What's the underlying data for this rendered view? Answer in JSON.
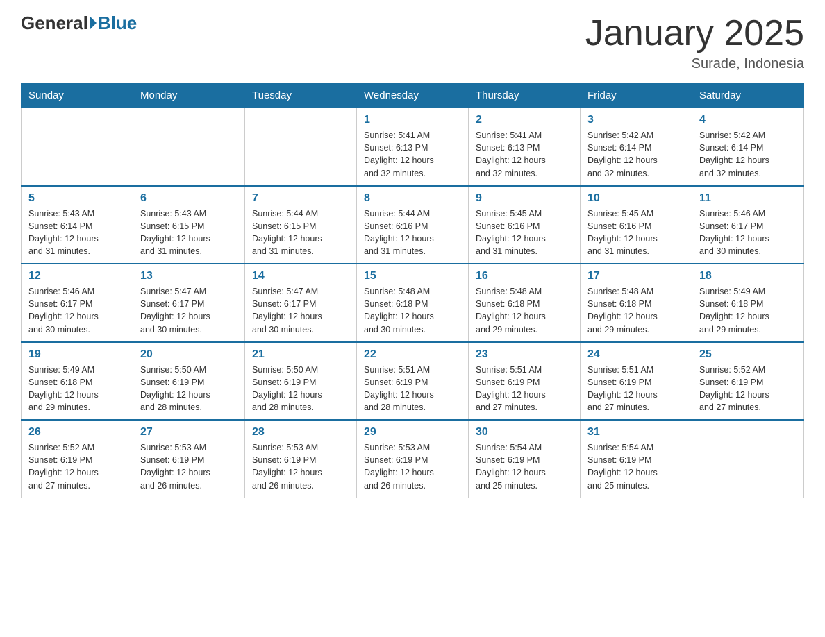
{
  "header": {
    "logo_general": "General",
    "logo_blue": "Blue",
    "month_title": "January 2025",
    "location": "Surade, Indonesia"
  },
  "weekdays": [
    "Sunday",
    "Monday",
    "Tuesday",
    "Wednesday",
    "Thursday",
    "Friday",
    "Saturday"
  ],
  "weeks": [
    [
      {
        "day": "",
        "info": ""
      },
      {
        "day": "",
        "info": ""
      },
      {
        "day": "",
        "info": ""
      },
      {
        "day": "1",
        "info": "Sunrise: 5:41 AM\nSunset: 6:13 PM\nDaylight: 12 hours\nand 32 minutes."
      },
      {
        "day": "2",
        "info": "Sunrise: 5:41 AM\nSunset: 6:13 PM\nDaylight: 12 hours\nand 32 minutes."
      },
      {
        "day": "3",
        "info": "Sunrise: 5:42 AM\nSunset: 6:14 PM\nDaylight: 12 hours\nand 32 minutes."
      },
      {
        "day": "4",
        "info": "Sunrise: 5:42 AM\nSunset: 6:14 PM\nDaylight: 12 hours\nand 32 minutes."
      }
    ],
    [
      {
        "day": "5",
        "info": "Sunrise: 5:43 AM\nSunset: 6:14 PM\nDaylight: 12 hours\nand 31 minutes."
      },
      {
        "day": "6",
        "info": "Sunrise: 5:43 AM\nSunset: 6:15 PM\nDaylight: 12 hours\nand 31 minutes."
      },
      {
        "day": "7",
        "info": "Sunrise: 5:44 AM\nSunset: 6:15 PM\nDaylight: 12 hours\nand 31 minutes."
      },
      {
        "day": "8",
        "info": "Sunrise: 5:44 AM\nSunset: 6:16 PM\nDaylight: 12 hours\nand 31 minutes."
      },
      {
        "day": "9",
        "info": "Sunrise: 5:45 AM\nSunset: 6:16 PM\nDaylight: 12 hours\nand 31 minutes."
      },
      {
        "day": "10",
        "info": "Sunrise: 5:45 AM\nSunset: 6:16 PM\nDaylight: 12 hours\nand 31 minutes."
      },
      {
        "day": "11",
        "info": "Sunrise: 5:46 AM\nSunset: 6:17 PM\nDaylight: 12 hours\nand 30 minutes."
      }
    ],
    [
      {
        "day": "12",
        "info": "Sunrise: 5:46 AM\nSunset: 6:17 PM\nDaylight: 12 hours\nand 30 minutes."
      },
      {
        "day": "13",
        "info": "Sunrise: 5:47 AM\nSunset: 6:17 PM\nDaylight: 12 hours\nand 30 minutes."
      },
      {
        "day": "14",
        "info": "Sunrise: 5:47 AM\nSunset: 6:17 PM\nDaylight: 12 hours\nand 30 minutes."
      },
      {
        "day": "15",
        "info": "Sunrise: 5:48 AM\nSunset: 6:18 PM\nDaylight: 12 hours\nand 30 minutes."
      },
      {
        "day": "16",
        "info": "Sunrise: 5:48 AM\nSunset: 6:18 PM\nDaylight: 12 hours\nand 29 minutes."
      },
      {
        "day": "17",
        "info": "Sunrise: 5:48 AM\nSunset: 6:18 PM\nDaylight: 12 hours\nand 29 minutes."
      },
      {
        "day": "18",
        "info": "Sunrise: 5:49 AM\nSunset: 6:18 PM\nDaylight: 12 hours\nand 29 minutes."
      }
    ],
    [
      {
        "day": "19",
        "info": "Sunrise: 5:49 AM\nSunset: 6:18 PM\nDaylight: 12 hours\nand 29 minutes."
      },
      {
        "day": "20",
        "info": "Sunrise: 5:50 AM\nSunset: 6:19 PM\nDaylight: 12 hours\nand 28 minutes."
      },
      {
        "day": "21",
        "info": "Sunrise: 5:50 AM\nSunset: 6:19 PM\nDaylight: 12 hours\nand 28 minutes."
      },
      {
        "day": "22",
        "info": "Sunrise: 5:51 AM\nSunset: 6:19 PM\nDaylight: 12 hours\nand 28 minutes."
      },
      {
        "day": "23",
        "info": "Sunrise: 5:51 AM\nSunset: 6:19 PM\nDaylight: 12 hours\nand 27 minutes."
      },
      {
        "day": "24",
        "info": "Sunrise: 5:51 AM\nSunset: 6:19 PM\nDaylight: 12 hours\nand 27 minutes."
      },
      {
        "day": "25",
        "info": "Sunrise: 5:52 AM\nSunset: 6:19 PM\nDaylight: 12 hours\nand 27 minutes."
      }
    ],
    [
      {
        "day": "26",
        "info": "Sunrise: 5:52 AM\nSunset: 6:19 PM\nDaylight: 12 hours\nand 27 minutes."
      },
      {
        "day": "27",
        "info": "Sunrise: 5:53 AM\nSunset: 6:19 PM\nDaylight: 12 hours\nand 26 minutes."
      },
      {
        "day": "28",
        "info": "Sunrise: 5:53 AM\nSunset: 6:19 PM\nDaylight: 12 hours\nand 26 minutes."
      },
      {
        "day": "29",
        "info": "Sunrise: 5:53 AM\nSunset: 6:19 PM\nDaylight: 12 hours\nand 26 minutes."
      },
      {
        "day": "30",
        "info": "Sunrise: 5:54 AM\nSunset: 6:19 PM\nDaylight: 12 hours\nand 25 minutes."
      },
      {
        "day": "31",
        "info": "Sunrise: 5:54 AM\nSunset: 6:19 PM\nDaylight: 12 hours\nand 25 minutes."
      },
      {
        "day": "",
        "info": ""
      }
    ]
  ]
}
